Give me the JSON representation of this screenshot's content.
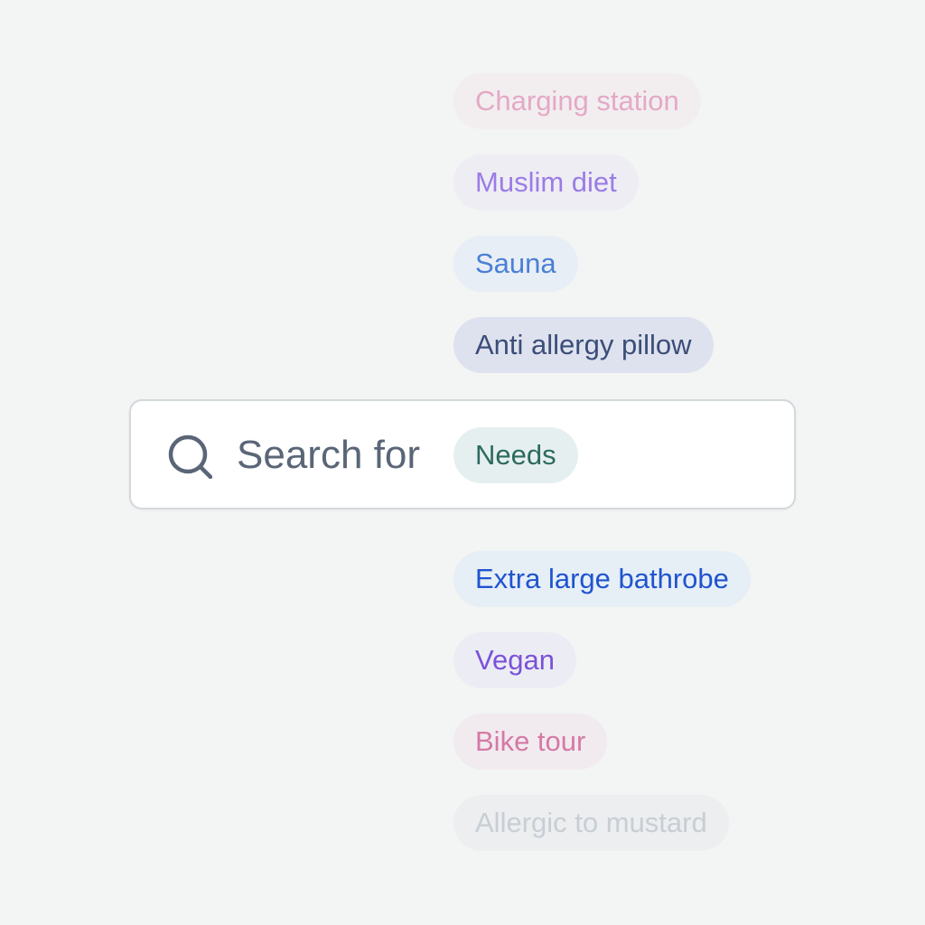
{
  "suggestions_above": [
    {
      "label": "Charging station",
      "color": "#e4a9c6",
      "bg": "#f2eef0"
    },
    {
      "label": "Muslim diet",
      "color": "#9b7ce6",
      "bg": "#eeedf4"
    },
    {
      "label": "Sauna",
      "color": "#4a7fd6",
      "bg": "#e8eef5"
    },
    {
      "label": "Anti allergy pillow",
      "color": "#3b4d78",
      "bg": "#dde2ee"
    }
  ],
  "search": {
    "label": "Search for",
    "category": "Needs",
    "icon": "search-icon"
  },
  "suggestions_below": [
    {
      "label": "Extra large bathrobe",
      "color": "#1f54cf",
      "bg": "#e6eef6"
    },
    {
      "label": "Vegan",
      "color": "#7a52d9",
      "bg": "#ececf4"
    },
    {
      "label": "Bike tour",
      "color": "#d679a6",
      "bg": "#f1ebef"
    },
    {
      "label": "Allergic to mustard",
      "color": "#c7ced5",
      "bg": "#eceeef"
    }
  ]
}
